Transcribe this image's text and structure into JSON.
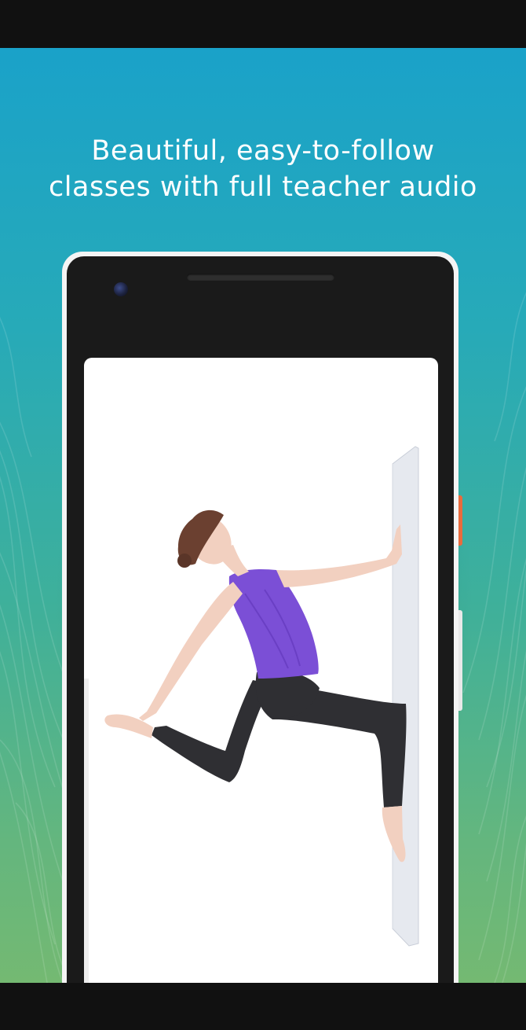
{
  "headline": {
    "line1": "Beautiful, easy-to-follow",
    "line2": "classes with full teacher audio"
  },
  "colors": {
    "gradient_top": "#1aa2c9",
    "gradient_bottom": "#74b972",
    "phone_body": "#1a1a1a",
    "phone_frame": "#f4f4f4",
    "side_button": "#e96b3d",
    "top_color": "#7b4fd6",
    "leggings": "#2f2f33"
  },
  "screen": {
    "image": "yoga-pose-photo"
  }
}
